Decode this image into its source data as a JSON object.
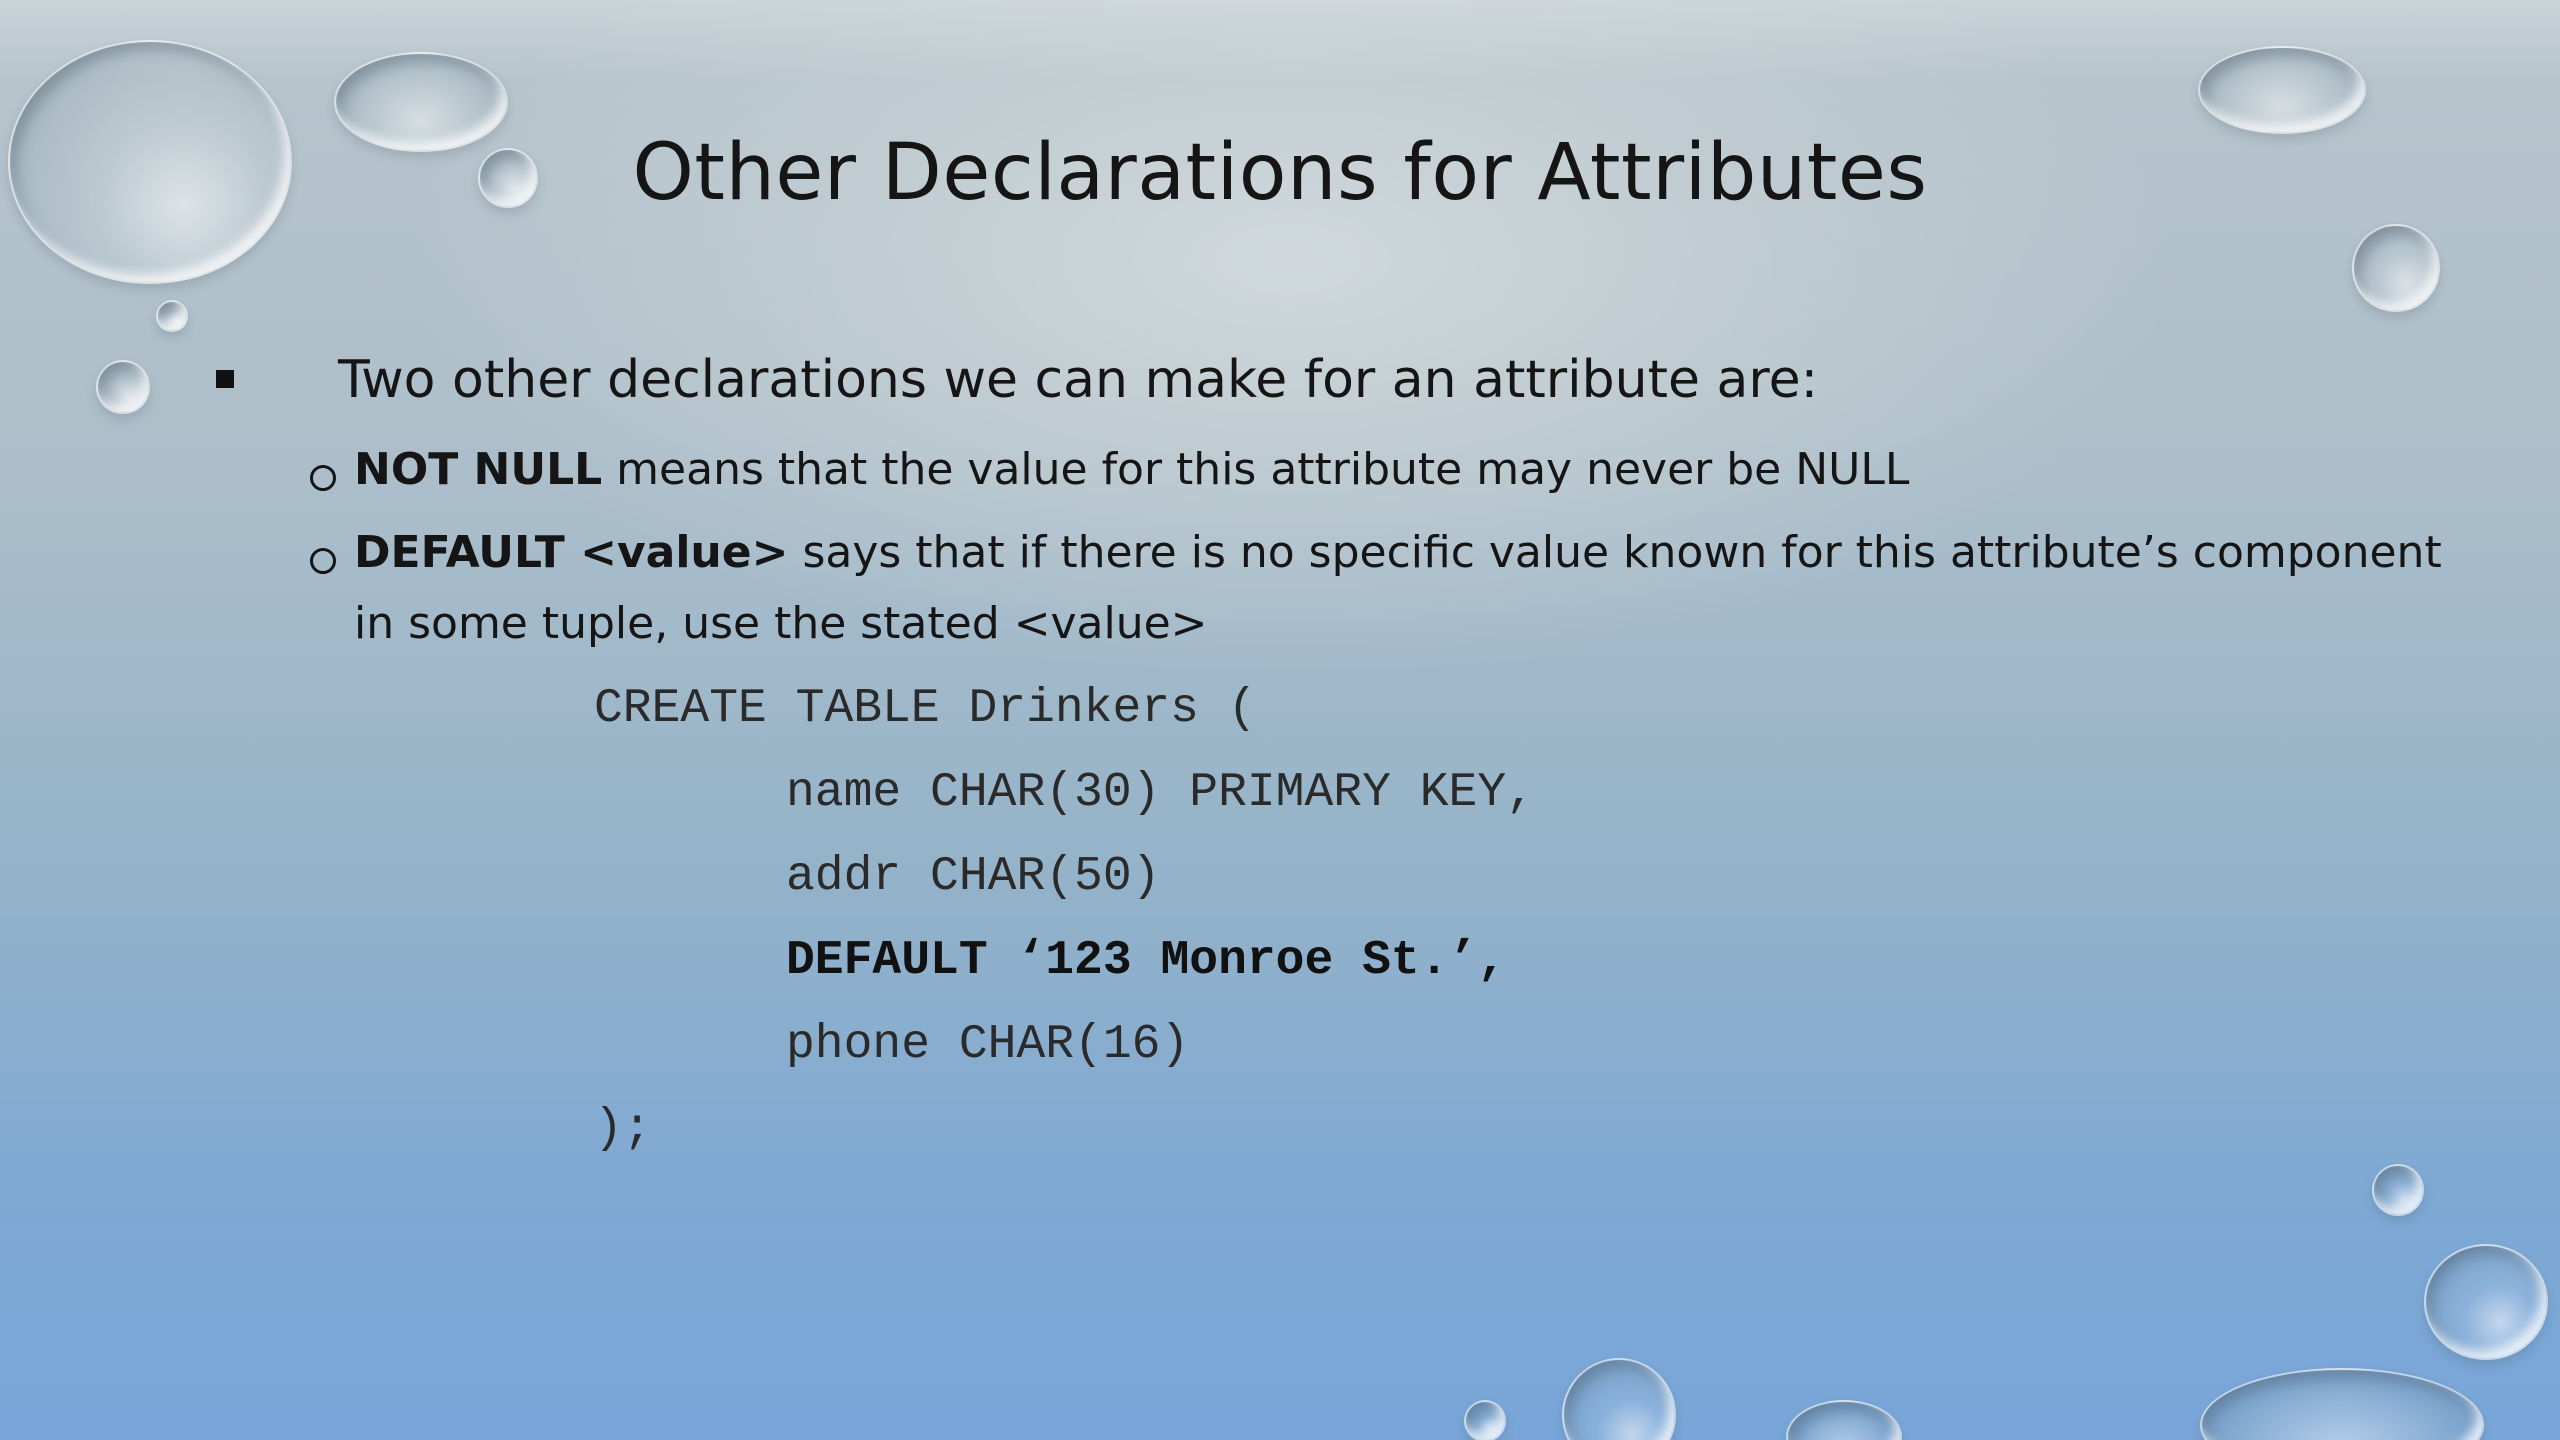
{
  "slide": {
    "title": "Other Declarations for Attributes",
    "main_bullet": "Two other declarations we can make for an attribute are:",
    "sub_bullets": [
      {
        "strong": "NOT NULL",
        "text": " means that the value for this attribute may never be NULL"
      },
      {
        "strong": "DEFAULT <value>",
        "text": " says that if there is no specific value known for this attribute’s component",
        "continuation": "in some tuple, use the stated <value>"
      }
    ],
    "code_lines": [
      "CREATE TABLE Drinkers (",
      "name CHAR(30) PRIMARY KEY,",
      "addr CHAR(50)",
      "DEFAULT ‘123 Monroe St.’,",
      "phone CHAR(16)",
      ");"
    ]
  },
  "colors": {
    "text": "#151515",
    "background_top": "#b8c5cc",
    "background_bottom": "#78a6d8"
  }
}
